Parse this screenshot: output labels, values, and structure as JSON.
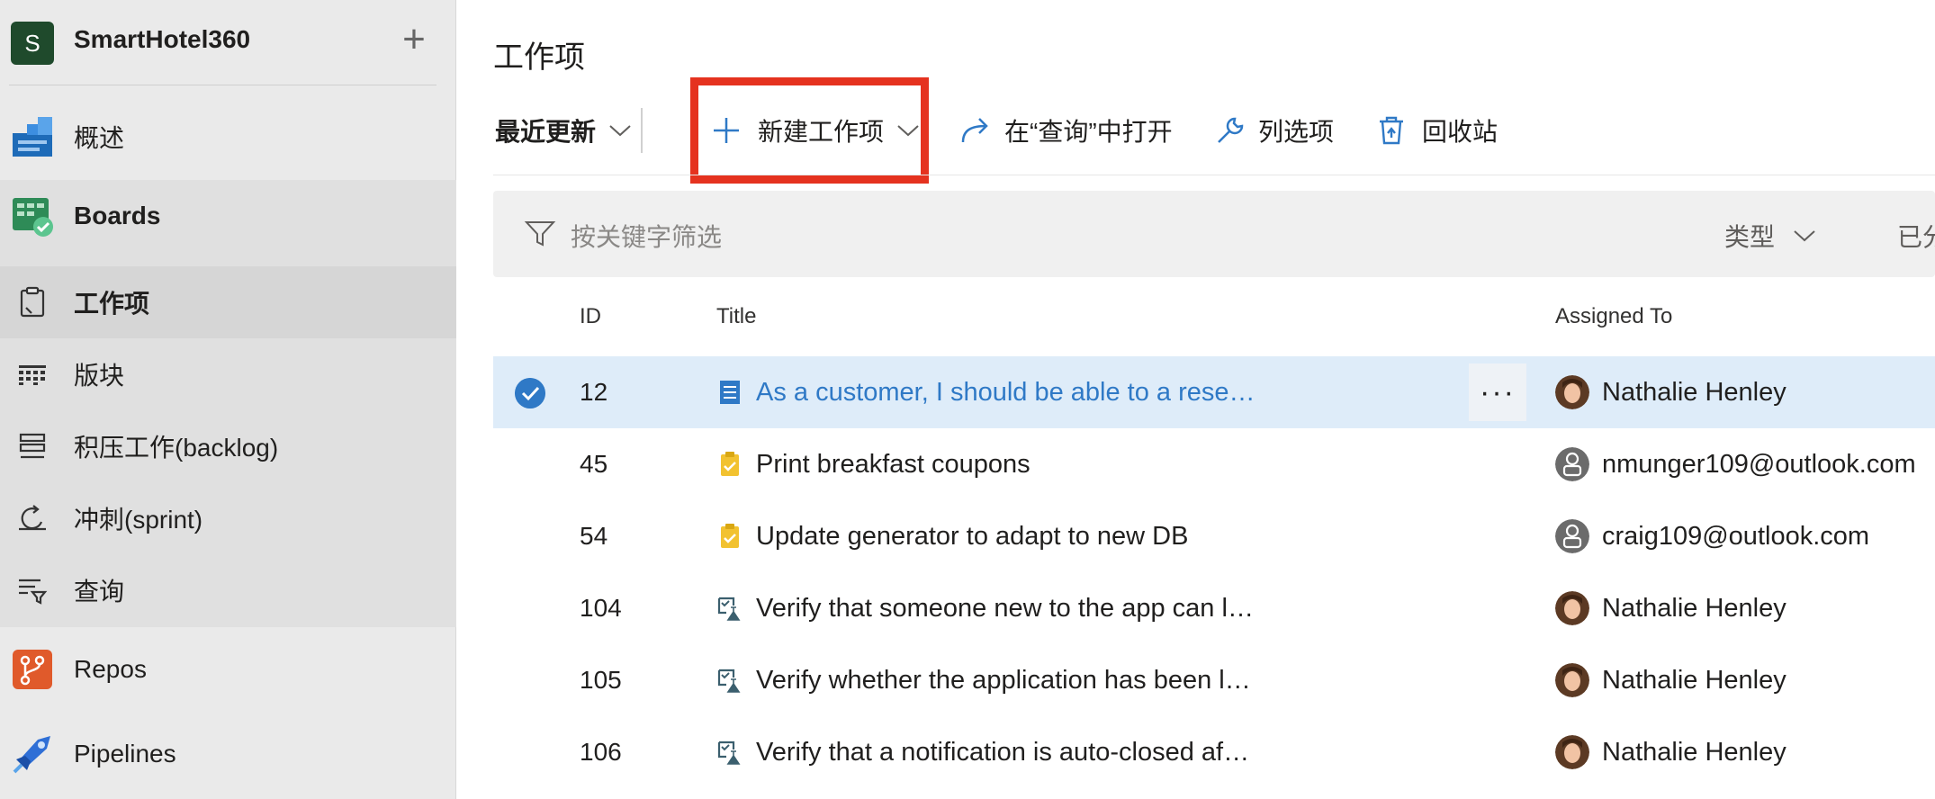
{
  "project": {
    "avatar_letter": "S",
    "name": "SmartHotel360",
    "add_label": "+"
  },
  "sidebar": {
    "items": [
      {
        "label": "概述"
      },
      {
        "label": "Boards"
      },
      {
        "label": "工作项"
      },
      {
        "label": "版块"
      },
      {
        "label": "积压工作(backlog)"
      },
      {
        "label": "冲刺(sprint)"
      },
      {
        "label": "查询"
      },
      {
        "label": "Repos"
      },
      {
        "label": "Pipelines"
      }
    ]
  },
  "page": {
    "title": "工作项"
  },
  "toolbar": {
    "view_label": "最近更新",
    "new_label": "新建工作项",
    "open_query_label": "在“查询”中打开",
    "column_options_label": "列选项",
    "recycle_bin_label": "回收站"
  },
  "filter": {
    "placeholder": "按关键字筛选",
    "type_label": "类型",
    "assigned_label": "已分配"
  },
  "table": {
    "headers": {
      "id": "ID",
      "title": "Title",
      "assigned": "Assigned To"
    },
    "rows": [
      {
        "id": "12",
        "title": "As a customer, I should be able to a reserve car",
        "type": "user-story",
        "assigned": "Nathalie Henley",
        "selected": true
      },
      {
        "id": "45",
        "title": "Print breakfast coupons",
        "type": "task",
        "assigned": "nmunger109@outlook.com"
      },
      {
        "id": "54",
        "title": "Update generator to adapt to new DB",
        "type": "task",
        "assigned": "craig109@outlook.com"
      },
      {
        "id": "104",
        "title": "Verify that someone new to the app can log in with Facebook id",
        "type": "test-case",
        "assigned": "Nathalie Henley"
      },
      {
        "id": "105",
        "title": "Verify whether the application has been launched successfully or…",
        "type": "test-case",
        "assigned": "Nathalie Henley"
      },
      {
        "id": "106",
        "title": "Verify that a notification is auto-closed after X seconds",
        "type": "test-case",
        "assigned": "Nathalie Henley"
      }
    ],
    "more_label": "···"
  },
  "colors": {
    "accent": "#2f79c6",
    "highlight": "#e5321f",
    "selected_row": "#deecf9",
    "task": "#f2c230"
  }
}
